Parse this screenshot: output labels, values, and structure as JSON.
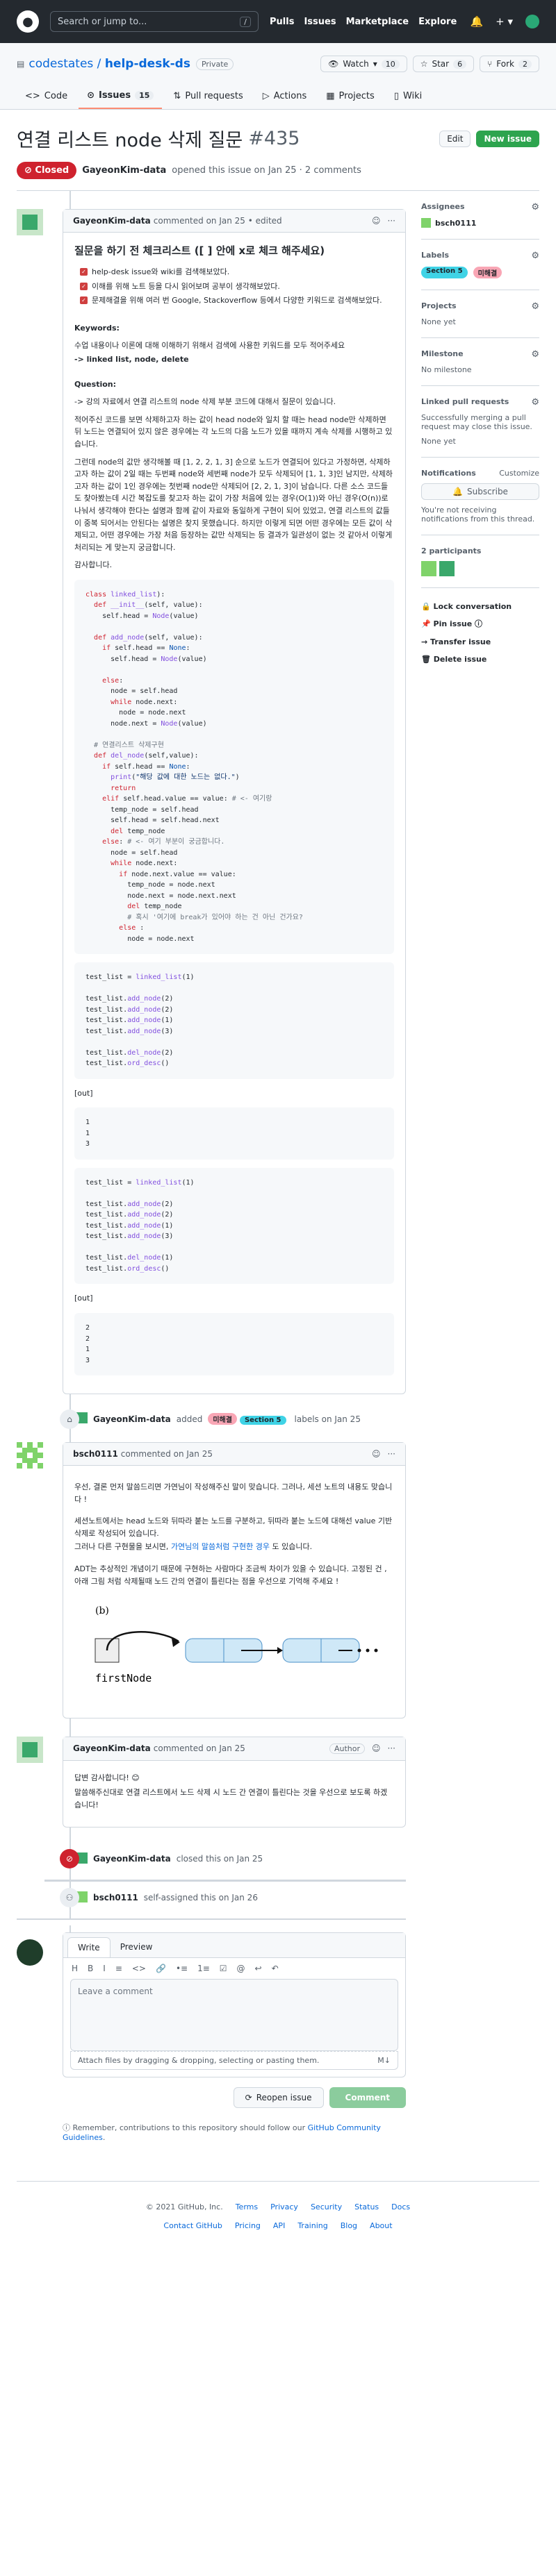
{
  "header": {
    "search_placeholder": "Search or jump to...",
    "search_kbd": "/",
    "nav": [
      "Pulls",
      "Issues",
      "Marketplace",
      "Explore"
    ]
  },
  "repo": {
    "owner": "codestates",
    "name": "help-desk-ds",
    "visibility": "Private",
    "watch_label": "Watch",
    "watch_count": "10",
    "star_label": "Star",
    "star_count": "6",
    "fork_label": "Fork",
    "fork_count": "2",
    "tabs": [
      {
        "label": "Code"
      },
      {
        "label": "Issues",
        "count": "15"
      },
      {
        "label": "Pull requests"
      },
      {
        "label": "Actions"
      },
      {
        "label": "Projects"
      },
      {
        "label": "Wiki"
      }
    ]
  },
  "issue": {
    "title": "연결 리스트 node 삭제 질문",
    "number": "#435",
    "edit_label": "Edit",
    "new_issue_label": "New issue",
    "state": "Closed",
    "author": "GayeonKim-data",
    "meta_text": "opened this issue on Jan 25 · 2 comments"
  },
  "first_comment": {
    "author": "GayeonKim-data",
    "meta": "commented on Jan 25 • edited",
    "heading": "질문을 하기 전 체크리스트 ([ ] 안에 x로 체크 해주세요)",
    "checks": [
      "help-desk issue와 wiki를 검색해보았다.",
      "이해를 위해 노트 등을 다시 읽어보며 공부이 생각해보았다.",
      "문제해결을 위해 여러 번 Google, Stackoverflow 등에서 다양한 키워드로 검색해보았다."
    ],
    "keywords_h": "Keywords:",
    "keywords_desc": "수업 내용이나 이론에 대해 이해하기 위해서 검색에 사용한 키워드를 모두 적어주세요",
    "keywords": "-> linked list, node, delete",
    "question_h": "Question:",
    "q1": "-> 강의 자료에서 연결 리스트의 node 삭제 부분 코드에 대해서 질문이 있습니다.",
    "q2": "적어주신 코드를 보면 삭제하고자 하는 값이 head node와 일치 할 때는 head node만 삭제하면 뒤 노드는 연결되어 있지 않은 경우에는 각 노드의 다음 노드가 있을 때까지 계속 삭제를 시행하고 있습니다.",
    "q3": "그런데 node의 값만 생각해볼 때 [1, 2, 2, 1, 3] 순으로 노드가 연결되어 있다고 가정하면, 삭제하고자 하는 값이 2일 때는 두번째 node와 세번째 node가 모두 삭제되어 [1, 1, 3]인 남지만, 삭제하고자 하는 값이 1인 경우에는 첫번째 node만 삭제되어 [2, 2, 1, 3]이 남습니다. 다른 소스 코드들도 찾아봤는데 시간 복잡도를 찾고자 하는 값이 가장 처음에 있는 경우(O(1))와 아닌 경우(O(n))로 나눠서 생각해야 한다는 설명과 함께 같이 자료와 동일하게 구현이 되어 있었고, 연결 리스트의 값들이 중복 되어서는 안된다는 설명은 찾지 못했습니다. 하지만 이렇게 되면 어떤 경우에는 모든 값이 삭제되고, 어떤 경우에는 가장 처음 등장하는 값만 삭제되는 등 결과가 일관성이 없는 것 같아서 이렇게 처리되는 게 맞는지 궁금합니다.",
    "thanks": "감사합니다.",
    "code1": [
      [
        [
          "kw",
          "class "
        ],
        [
          "fn",
          "linked_list"
        ],
        [
          "",
          "):"
        ]
      ],
      [
        [
          "",
          "  "
        ],
        [
          "kw",
          "def "
        ],
        [
          "fn",
          "__init__"
        ],
        [
          "",
          "(self, value):"
        ]
      ],
      [
        [
          "",
          "    self.head = "
        ],
        [
          "fn",
          "Node"
        ],
        [
          "",
          "(value)"
        ]
      ],
      [
        [
          "",
          ""
        ]
      ],
      [
        [
          "",
          "  "
        ],
        [
          "kw",
          "def "
        ],
        [
          "fn",
          "add_node"
        ],
        [
          "",
          "(self, value):"
        ]
      ],
      [
        [
          "",
          "    "
        ],
        [
          "kw",
          "if "
        ],
        [
          "",
          "self.head == "
        ],
        [
          "bl",
          "None"
        ],
        [
          "",
          ":"
        ]
      ],
      [
        [
          "",
          "      self.head = "
        ],
        [
          "fn",
          "Node"
        ],
        [
          "",
          "(value)"
        ]
      ],
      [
        [
          "",
          ""
        ]
      ],
      [
        [
          "",
          "    "
        ],
        [
          "kw",
          "else"
        ],
        [
          "",
          ":"
        ]
      ],
      [
        [
          "",
          "      node = self.head"
        ]
      ],
      [
        [
          "",
          "      "
        ],
        [
          "kw",
          "while "
        ],
        [
          "",
          "node.next:"
        ]
      ],
      [
        [
          "",
          "        node = node.next"
        ]
      ],
      [
        [
          "",
          "      node.next = "
        ],
        [
          "fn",
          "Node"
        ],
        [
          "",
          "(value)"
        ]
      ],
      [
        [
          "",
          ""
        ]
      ],
      [
        [
          "",
          "  "
        ],
        [
          "cm",
          "# 연결리스트 삭제구현"
        ]
      ],
      [
        [
          "",
          "  "
        ],
        [
          "kw",
          "def "
        ],
        [
          "fn",
          "del_node"
        ],
        [
          "",
          "(self,value):"
        ]
      ],
      [
        [
          "",
          "    "
        ],
        [
          "kw",
          "if "
        ],
        [
          "",
          "self.head == "
        ],
        [
          "bl",
          "None"
        ],
        [
          "",
          ":"
        ]
      ],
      [
        [
          "",
          "      "
        ],
        [
          "fn",
          "print"
        ],
        [
          "",
          "("
        ],
        [
          "str",
          "\"해당 값에 대한 노드는 없다.\""
        ],
        [
          "",
          ")"
        ]
      ],
      [
        [
          "",
          "      "
        ],
        [
          "kw",
          "return"
        ]
      ],
      [
        [
          "",
          "    "
        ],
        [
          "kw",
          "elif "
        ],
        [
          "",
          "self.head.value == value: "
        ],
        [
          "cm",
          "# <- 여기랑"
        ]
      ],
      [
        [
          "",
          "      temp_node = self.head"
        ]
      ],
      [
        [
          "",
          "      self.head = self.head.next"
        ]
      ],
      [
        [
          "",
          "      "
        ],
        [
          "kw",
          "del "
        ],
        [
          "",
          "temp_node"
        ]
      ],
      [
        [
          "",
          "    "
        ],
        [
          "kw",
          "else"
        ],
        [
          "",
          ": "
        ],
        [
          "cm",
          "# <- 여기 부분이 궁금합니다."
        ]
      ],
      [
        [
          "",
          "      node = self.head"
        ]
      ],
      [
        [
          "",
          "      "
        ],
        [
          "kw",
          "while "
        ],
        [
          "",
          "node.next:"
        ]
      ],
      [
        [
          "",
          "        "
        ],
        [
          "kw",
          "if "
        ],
        [
          "",
          "node.next.value == value:"
        ]
      ],
      [
        [
          "",
          "          temp_node = node.next"
        ]
      ],
      [
        [
          "",
          "          node.next = node.next.next"
        ]
      ],
      [
        [
          "",
          "          "
        ],
        [
          "kw",
          "del "
        ],
        [
          "",
          "temp_node"
        ]
      ],
      [
        [
          "",
          "          "
        ],
        [
          "cm",
          "# 혹시 '여기에 break가 있어야 하는 건 아닌 건가요?"
        ]
      ],
      [
        [
          "",
          "        "
        ],
        [
          "kw",
          "else "
        ],
        [
          "",
          ":"
        ]
      ],
      [
        [
          "",
          "          node = node.next"
        ]
      ]
    ],
    "code2": [
      [
        [
          "",
          "test_list = "
        ],
        [
          "fn",
          "linked_list"
        ],
        [
          "",
          "(1)"
        ]
      ],
      [
        [
          "",
          ""
        ]
      ],
      [
        [
          "",
          "test_list."
        ],
        [
          "fn",
          "add_node"
        ],
        [
          "",
          "(2)"
        ]
      ],
      [
        [
          "",
          "test_list."
        ],
        [
          "fn",
          "add_node"
        ],
        [
          "",
          "(2)"
        ]
      ],
      [
        [
          "",
          "test_list."
        ],
        [
          "fn",
          "add_node"
        ],
        [
          "",
          "(1)"
        ]
      ],
      [
        [
          "",
          "test_list."
        ],
        [
          "fn",
          "add_node"
        ],
        [
          "",
          "(3)"
        ]
      ],
      [
        [
          "",
          ""
        ]
      ],
      [
        [
          "",
          "test_list."
        ],
        [
          "fn",
          "del_node"
        ],
        [
          "",
          "(2)"
        ]
      ],
      [
        [
          "",
          "test_list."
        ],
        [
          "fn",
          "ord_desc"
        ],
        [
          "",
          "()"
        ]
      ]
    ],
    "out_label": "[out]",
    "out1": "1\n1\n3",
    "code3": [
      [
        [
          "",
          "test_list = "
        ],
        [
          "fn",
          "linked_list"
        ],
        [
          "",
          "(1)"
        ]
      ],
      [
        [
          "",
          ""
        ]
      ],
      [
        [
          "",
          "test_list."
        ],
        [
          "fn",
          "add_node"
        ],
        [
          "",
          "(2)"
        ]
      ],
      [
        [
          "",
          "test_list."
        ],
        [
          "fn",
          "add_node"
        ],
        [
          "",
          "(2)"
        ]
      ],
      [
        [
          "",
          "test_list."
        ],
        [
          "fn",
          "add_node"
        ],
        [
          "",
          "(1)"
        ]
      ],
      [
        [
          "",
          "test_list."
        ],
        [
          "fn",
          "add_node"
        ],
        [
          "",
          "(3)"
        ]
      ],
      [
        [
          "",
          ""
        ]
      ],
      [
        [
          "",
          "test_list."
        ],
        [
          "fn",
          "del_node"
        ],
        [
          "",
          "(1)"
        ]
      ],
      [
        [
          "",
          "test_list."
        ],
        [
          "fn",
          "ord_desc"
        ],
        [
          "",
          "()"
        ]
      ]
    ],
    "out2": "2\n2\n1\n3"
  },
  "label_event": {
    "actor": "GayeonKim-data",
    "pre": "added",
    "labels": [
      {
        "name": "미해결",
        "color": "#f9a6b5"
      },
      {
        "name": "Section 5",
        "color": "#3fd3e6"
      }
    ],
    "post": "labels on Jan 25"
  },
  "second_comment": {
    "author": "bsch0111",
    "meta": "commented on Jan 25",
    "p1": "우선, 결론 먼저 말씀드리면 가연님이 작성해주신 말이 맞습니다. 그러나, 세션 노트의 내용도 맞습니다 !",
    "p2a": "세션노트에서는 head 노드와 뒤따라 붙는 노드를 구분하고, 뒤따라 붙는 노드에 대해선 value 기반 삭제로 작성되어 있습니다.",
    "p2b": "그러나 다른 구현물을 보시면, ",
    "p2link": "가연님의 말씀처럼 구현한 경우",
    "p2c": " 도 있습니다.",
    "p3": "ADT는 추상적인 개념이기 때문에 구현하는 사람마다 조금씩 차이가 있을 수 있습니다. 고정된 건 , 아래 그림 처럼 삭제될때 노드 간의 연결이 틀린다는 점을 우선으로 기억해 주세요 !",
    "fig_label": "(b)",
    "fig_caption": "firstNode"
  },
  "third_comment": {
    "author": "GayeonKim-data",
    "meta": "commented on Jan 25",
    "role": "Author",
    "p1": "답변 감사합니다! 😊",
    "p2": "말씀해주신대로 연결 리스트에서 노드 삭제 시 노드 간 연결이 틀린다는 것을 우선으로 보도록 하겠습니다!"
  },
  "close_event": {
    "actor": "GayeonKim-data",
    "text": "closed this on Jan 25"
  },
  "assign_event": {
    "actor": "bsch0111",
    "text": "self-assigned this on Jan 26"
  },
  "composer": {
    "tab_write": "Write",
    "tab_preview": "Preview",
    "toolbar": [
      "H",
      "B",
      "I",
      "≡",
      "<>",
      "🔗",
      "•≡",
      "1≡",
      "☑",
      "@",
      "↩",
      "↶"
    ],
    "placeholder": "Leave a comment",
    "attach": "Attach files by dragging & dropping, selecting or pasting them.",
    "reopen": "Reopen issue",
    "comment": "Comment",
    "note_pre": "Remember, contributions to this repository should follow our ",
    "note_link": "GitHub Community Guidelines",
    "note_post": "."
  },
  "sidebar": {
    "assignees_h": "Assignees",
    "assignee": "bsch0111",
    "labels_h": "Labels",
    "labels": [
      {
        "name": "Section 5",
        "color": "#3fd3e6"
      },
      {
        "name": "미해결",
        "color": "#f9a6b5"
      }
    ],
    "projects_h": "Projects",
    "projects_v": "None yet",
    "milestone_h": "Milestone",
    "milestone_v": "No milestone",
    "linked_h": "Linked pull requests",
    "linked_desc": "Successfully merging a pull request may close this issue.",
    "linked_v": "None yet",
    "notif_h": "Notifications",
    "notif_customize": "Customize",
    "subscribe": "Subscribe",
    "notif_desc": "You're not receiving notifications from this thread.",
    "participants_h": "2 participants",
    "lock": "Lock conversation",
    "pin": "Pin issue",
    "transfer": "Transfer issue",
    "delete": "Delete issue"
  },
  "footer": {
    "copyright": "© 2021 GitHub, Inc.",
    "row1": [
      "Terms",
      "Privacy",
      "Security",
      "Status",
      "Docs"
    ],
    "row2": [
      "Contact GitHub",
      "Pricing",
      "API",
      "Training",
      "Blog",
      "About"
    ]
  }
}
